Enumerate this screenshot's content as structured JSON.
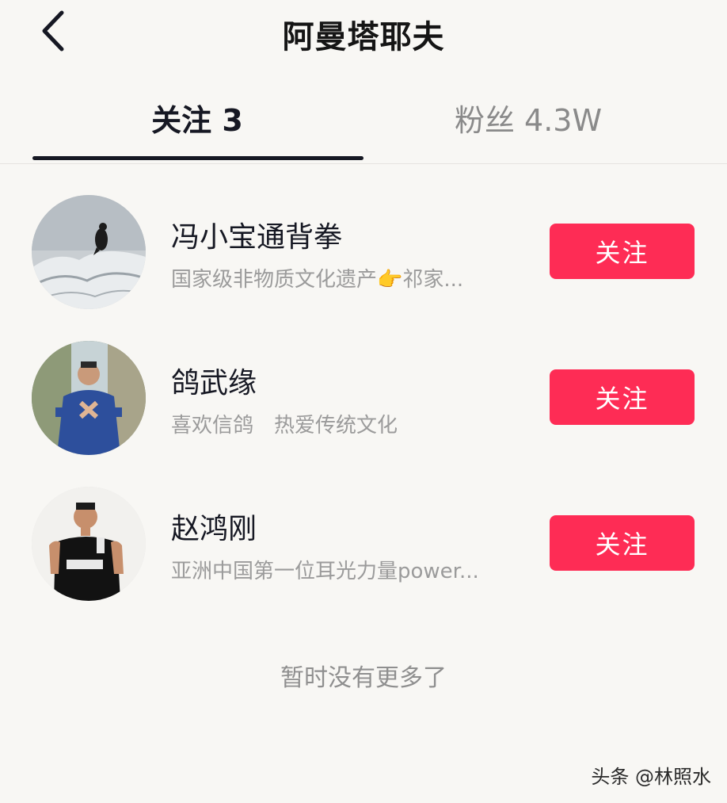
{
  "header": {
    "title": "阿曼塔耶夫",
    "back_icon": "chevron-left-icon"
  },
  "tabs": [
    {
      "label": "关注 3",
      "active": true
    },
    {
      "label": "粉丝 4.3W",
      "active": false
    }
  ],
  "users": [
    {
      "name": "冯小宝通背拳",
      "description": "国家级非物质文化遗产👉祁家...",
      "follow_label": "关注",
      "avatar": "bird-on-snow-avatar"
    },
    {
      "name": "鸽武缘",
      "description": "喜欢信鸽　热爱传统文化",
      "follow_label": "关注",
      "avatar": "man-in-blue-robe-avatar"
    },
    {
      "name": "赵鸿刚",
      "description": "亚洲中国第一位耳光力量power...",
      "follow_label": "关注",
      "avatar": "man-in-black-shirt-avatar"
    }
  ],
  "footer": {
    "no_more_text": "暂时没有更多了",
    "watermark": "头条 @林照水"
  },
  "colors": {
    "background": "#f8f7f4",
    "follow_button": "#fe2c55",
    "active_tab": "#161823",
    "inactive_tab": "#8a8a8a",
    "secondary_text": "#9b9b9b"
  }
}
